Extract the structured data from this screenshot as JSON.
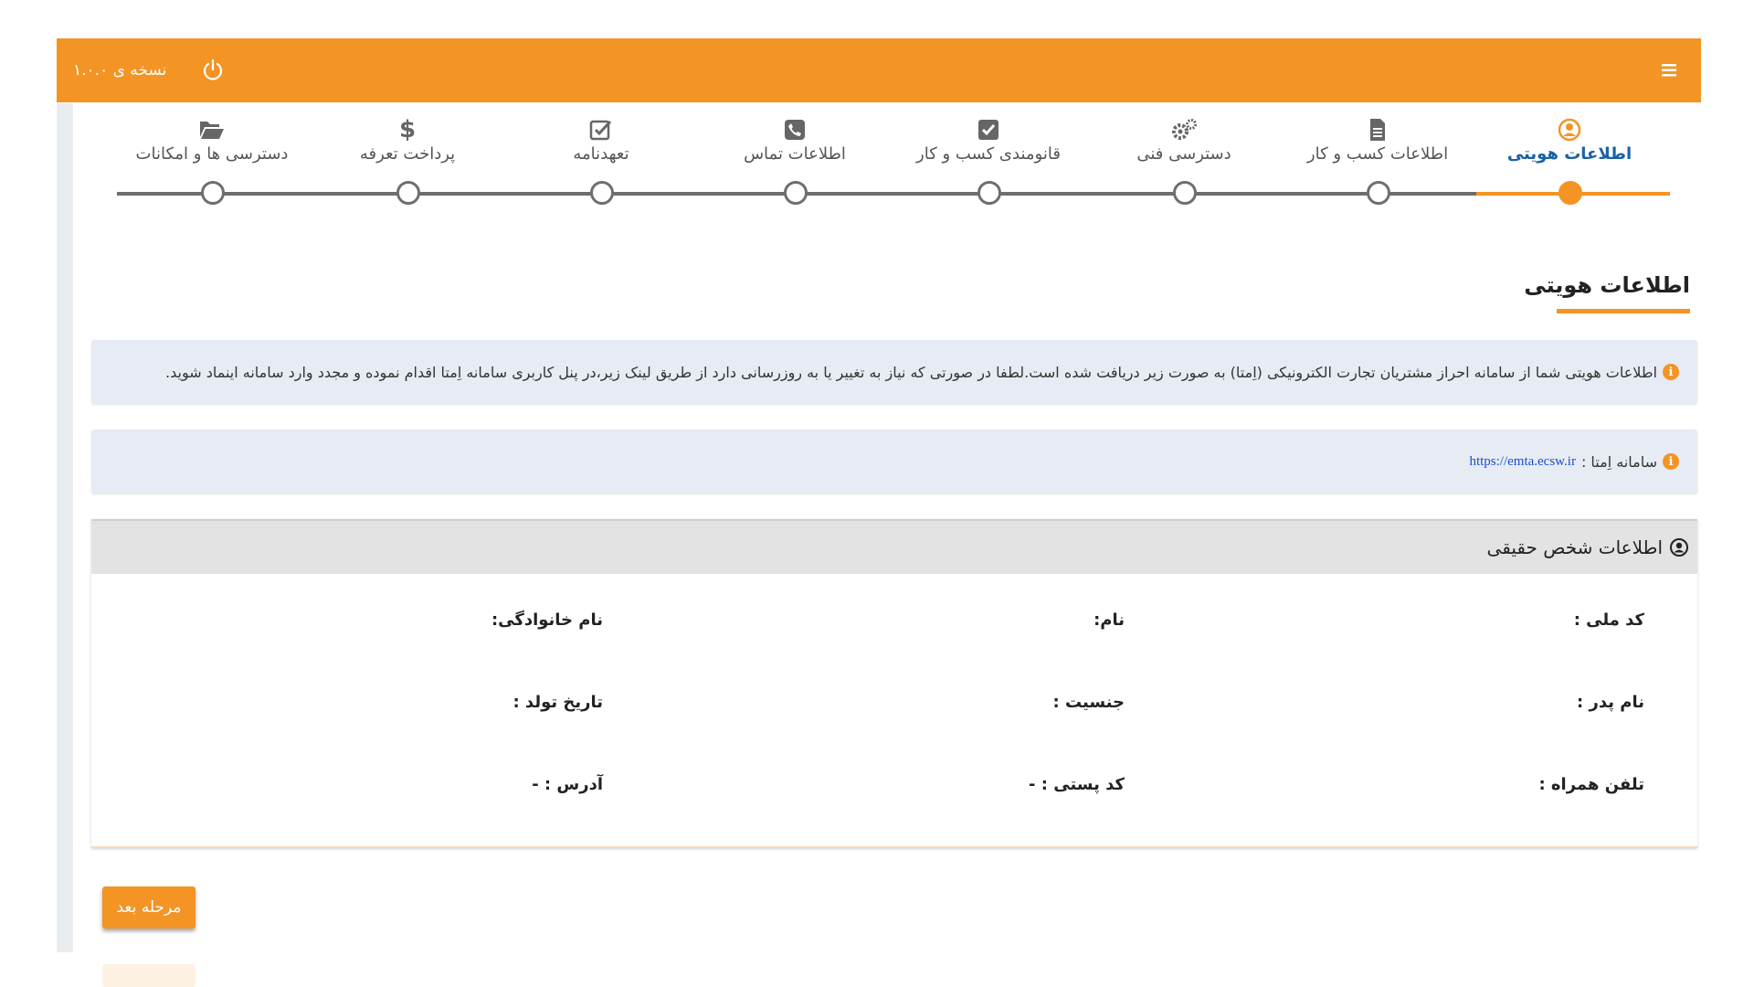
{
  "header": {
    "version": "نسخه ی ۱.۰.۰",
    "menu_icon": "hamburger-menu-icon",
    "power_icon": "power-icon"
  },
  "stepper": {
    "active_index": 0,
    "steps": [
      {
        "label": "اطلاعات هویتی",
        "icon": "user-circle-icon"
      },
      {
        "label": "اطلاعات کسب و کار",
        "icon": "document-icon"
      },
      {
        "label": "دسترسی فنی",
        "icon": "gears-icon"
      },
      {
        "label": "قانومندی کسب و کار",
        "icon": "checkbox-icon"
      },
      {
        "label": "اطلاعات تماس",
        "icon": "phone-icon"
      },
      {
        "label": "تعهدنامه",
        "icon": "check-square-icon"
      },
      {
        "label": "پرداخت تعرفه",
        "icon": "dollar-icon"
      },
      {
        "label": "دسترسی ها و امکانات",
        "icon": "folder-open-icon"
      }
    ]
  },
  "section": {
    "title": "اطلاعات هویتی"
  },
  "alerts": {
    "identity_info": "اطلاعات هویتی شما از سامانه احراز مشتریان تجارت الکترونیکی (اِمتا) به صورت زیر دریافت شده است.لطفا در صورتی که نیاز به تغییر یا به روزرسانی دارد از طریق لینک زیر،در پنل کاربری سامانه اِمتا اقدام نموده و مجدد وارد سامانه اینماد شوید.",
    "emta_label": "سامانه اِمتا :",
    "emta_link": "https://emta.ecsw.ir"
  },
  "panel": {
    "title": "اطلاعات شخص حقیقی",
    "fields": {
      "national_code": "کد ملی :",
      "first_name": "نام:",
      "last_name": "نام خانوادگی:",
      "father_name": "نام پدر :",
      "gender": "جنسیت :",
      "birth_date": "تاریخ تولد :",
      "mobile": "تلفن همراه :",
      "postal_code": "کد پستی : -",
      "address": "آدرس : -"
    }
  },
  "actions": {
    "next_label": "مرحله بعد"
  },
  "colors": {
    "accent": "#f39425",
    "active_step": "#1a61a6",
    "alert_bg": "#e7ebf3",
    "link": "#1a4fd1"
  }
}
